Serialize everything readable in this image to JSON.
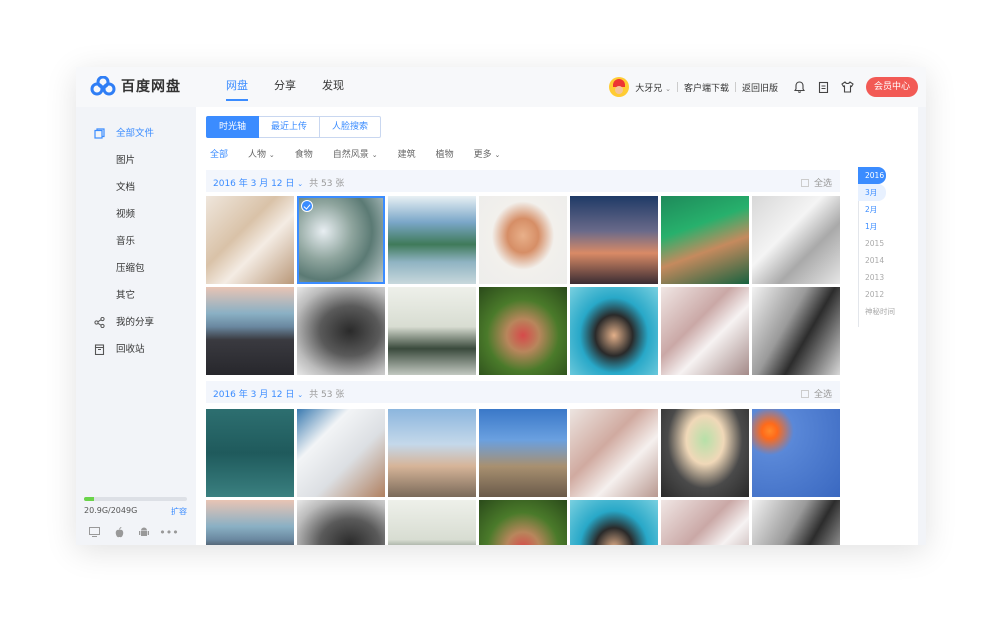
{
  "app": {
    "title": "百度网盘"
  },
  "nav": {
    "items": [
      {
        "label": "网盘",
        "active": true
      },
      {
        "label": "分享",
        "active": false
      },
      {
        "label": "发现",
        "active": false
      }
    ]
  },
  "header": {
    "username": "大牙兄",
    "client_download": "客户端下载",
    "old_version": "返回旧版",
    "vip_label": "会员中心",
    "icons": [
      "bell-icon",
      "clipboard-icon",
      "tshirt-icon"
    ]
  },
  "sidebar": {
    "items": [
      {
        "label": "全部文件",
        "icon": "files-icon",
        "active": true
      },
      {
        "label": "图片"
      },
      {
        "label": "文档"
      },
      {
        "label": "视频"
      },
      {
        "label": "音乐"
      },
      {
        "label": "压缩包"
      },
      {
        "label": "其它"
      },
      {
        "label": "我的分享",
        "icon": "share-icon"
      },
      {
        "label": "回收站",
        "icon": "trash-icon"
      }
    ],
    "storage": {
      "used_text": "20.9G/2049G",
      "expand": "扩容",
      "fill_fraction": 0.1
    },
    "platforms": [
      "monitor-icon",
      "apple-icon",
      "android-icon",
      "more-icon"
    ]
  },
  "tabs": [
    {
      "label": "时光轴",
      "active": true
    },
    {
      "label": "最近上传"
    },
    {
      "label": "人脸搜索"
    }
  ],
  "filters": [
    {
      "label": "全部",
      "active": true
    },
    {
      "label": "人物",
      "dropdown": true
    },
    {
      "label": "食物"
    },
    {
      "label": "自然风景",
      "dropdown": true
    },
    {
      "label": "建筑"
    },
    {
      "label": "植物"
    },
    {
      "label": "更多",
      "dropdown": true
    }
  ],
  "groups": [
    {
      "date": "2016 年 3 月 12 日",
      "count": "共 53 张",
      "select_all": "全选"
    },
    {
      "date": "2016 年 3 月 12 日",
      "count": "共 53 张",
      "select_all": "全选"
    }
  ],
  "timeline": {
    "items": [
      "2016",
      "3月",
      "2月",
      "1月",
      "2015",
      "2014",
      "2013",
      "2012",
      "神秘时间"
    ]
  },
  "colors": {
    "accent": "#3b8cff",
    "vip": "#f25a55",
    "storage": "#6ad44a"
  }
}
